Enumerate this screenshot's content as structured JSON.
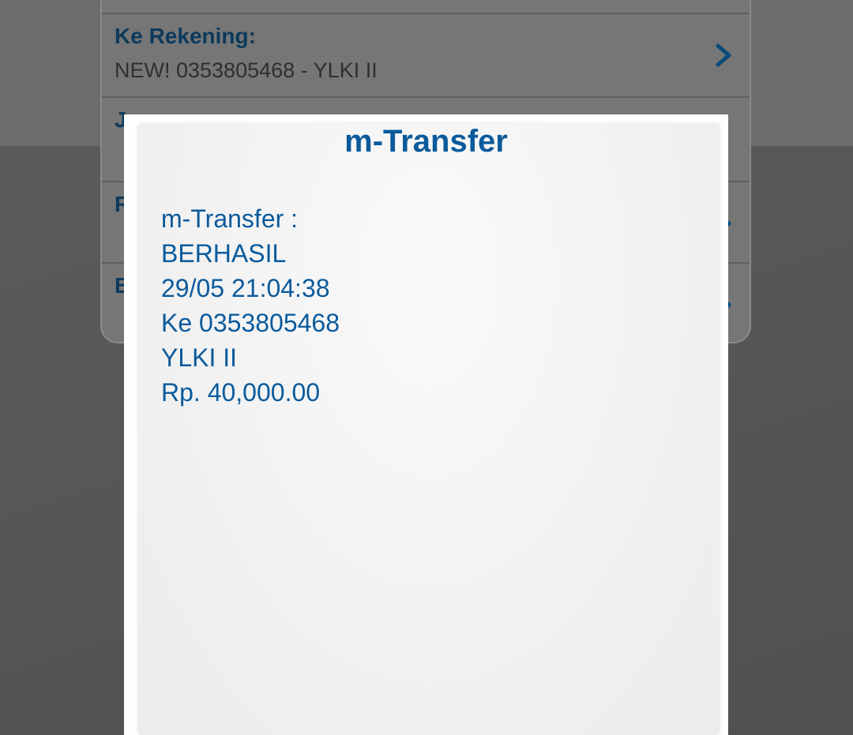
{
  "background_form": {
    "rows": [
      {
        "label": "",
        "value": ""
      },
      {
        "label": "Ke Rekening:",
        "value": "NEW! 0353805468 - YLKI II"
      },
      {
        "label": "J",
        "value": ""
      },
      {
        "label": "R",
        "value": ""
      },
      {
        "label": "B",
        "value": ""
      }
    ],
    "chevron_icon": "chevron-right-icon"
  },
  "dialog": {
    "title": "m-Transfer",
    "lines": [
      "m-Transfer :",
      "BERHASIL",
      "29/05 21:04:38",
      "Ke 0353805468",
      "YLKI II",
      "Rp. 40,000.00"
    ]
  },
  "colors": {
    "accent": "#0a5a9c",
    "overlay_background": "#535353",
    "dialog_background": "#ffffff"
  }
}
